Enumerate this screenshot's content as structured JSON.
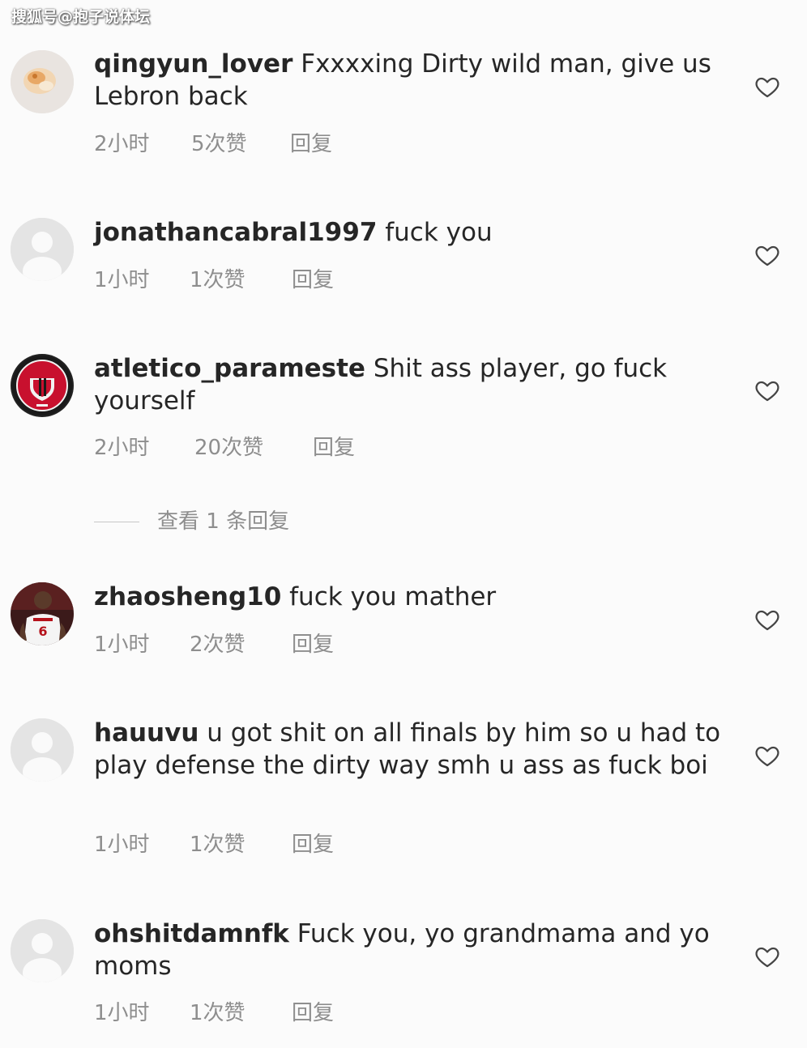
{
  "watermark": "搜狐号@抱子说体坛",
  "comments": [
    {
      "username": "qingyun_lover",
      "text": "Fxxxxing Dirty wild man,  give us Lebron back",
      "time": "2小时",
      "likes": "5次赞",
      "reply": "回复",
      "avatar": "food-photo-avatar"
    },
    {
      "username": "jonathancabral1997",
      "text": "fuck you",
      "time": "1小时",
      "likes": "1次赞",
      "reply": "回复",
      "avatar": "default-user-avatar"
    },
    {
      "username": "atletico_parameste",
      "text": "Shit ass player, go fuck yourself",
      "time": "2小时",
      "likes": "20次赞",
      "reply": "回复",
      "avatar": "club-crest-avatar"
    },
    {
      "username": "zhaosheng10",
      "text": "fuck you mather",
      "time": "1小时",
      "likes": "2次赞",
      "reply": "回复",
      "avatar": "player-jersey-6-avatar"
    },
    {
      "username": "hauuvu",
      "text": "u got shit on all finals by him so u had to play defense the dirty way smh u ass as fuck boi",
      "time": "1小时",
      "likes": "1次赞",
      "reply": "回复",
      "avatar": "default-user-avatar"
    },
    {
      "username": "ohshitdamnfk",
      "text": "Fuck you, yo grandmama and yo moms",
      "time": "1小时",
      "likes": "1次赞",
      "reply": "回复",
      "avatar": "default-user-avatar"
    }
  ],
  "view_replies": "查看 1 条回复",
  "icons": {
    "like": "heart-outline-icon"
  },
  "colors": {
    "text": "#262626",
    "meta": "#8e8e8e",
    "background": "#fbfbfb"
  }
}
